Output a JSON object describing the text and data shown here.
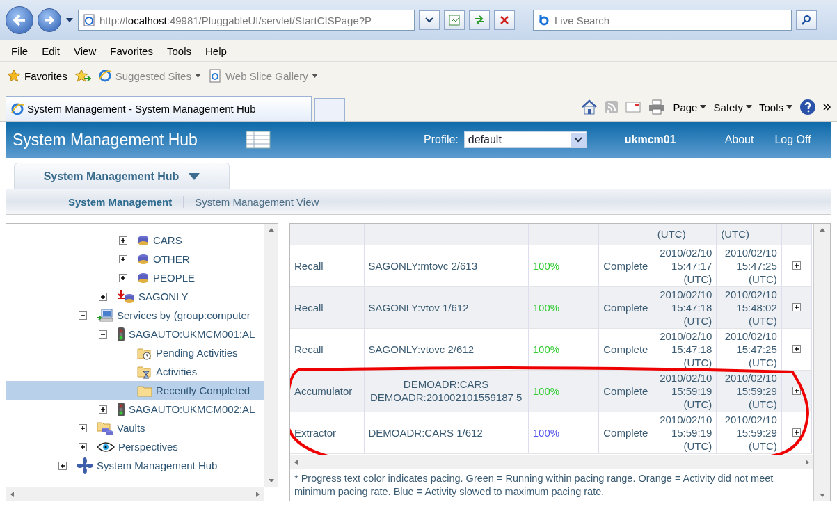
{
  "browser": {
    "address": "http://**localhost**:49981/PluggableUI/servlet/StartCISPage?P",
    "search": {
      "placeholder": "Live Search"
    },
    "menu": [
      "File",
      "Edit",
      "View",
      "Favorites",
      "Tools",
      "Help"
    ],
    "favorites": {
      "label": "Favorites",
      "links": [
        {
          "label": "Suggested Sites",
          "kind": "ie"
        },
        {
          "label": "Web Slice Gallery",
          "kind": "page"
        }
      ]
    },
    "tab": {
      "title": "System Management - System Management Hub"
    },
    "commands": [
      "Page",
      "Safety",
      "Tools"
    ]
  },
  "header": {
    "title": "System Management Hub",
    "profile_label": "Profile:",
    "profile": "default",
    "user": "ukmcm01",
    "links": [
      "About",
      "Log Off"
    ]
  },
  "hub_tab": {
    "label": "System Management Hub"
  },
  "subnav": [
    {
      "label": "System Management",
      "selected": true
    },
    {
      "label": "System Management View",
      "selected": false
    }
  ],
  "tree": [
    {
      "children": [
        {
          "children": [
            {
              "children": [
                {
                  "label": "CARS",
                  "kind": "database",
                  "expanded": false,
                  "selected": false
                },
                {
                  "label": "OTHER",
                  "kind": "database",
                  "expanded": false,
                  "selected": false
                },
                {
                  "label": "PEOPLE",
                  "kind": "database",
                  "expanded": false,
                  "selected": false
                }
              ]
            },
            {
              "label": "SAGONLY",
              "kind": "database-import",
              "expanded": false,
              "selected": false
            }
          ]
        },
        {
          "label": "Services by (group:computer",
          "kind": "computer",
          "expanded": true,
          "selected": false,
          "children": [
            {
              "label": "SAGAUTO:UKMCM001:AL",
              "kind": "traffic-light",
              "expanded": true,
              "selected": false,
              "children": [
                {
                  "label": "Pending Activities",
                  "kind": "folder-clock",
                  "selected": false
                },
                {
                  "label": "Activities",
                  "kind": "folder-hourglass",
                  "selected": false
                },
                {
                  "label": "Recently Completed",
                  "kind": "folder",
                  "selected": true
                }
              ]
            },
            {
              "label": "SAGAUTO:UKMCM002:AL",
              "kind": "traffic-light",
              "expanded": false,
              "selected": false
            }
          ]
        },
        {
          "label": "Vaults",
          "kind": "vaults",
          "expanded": false,
          "selected": false
        },
        {
          "label": "Perspectives",
          "kind": "eye",
          "expanded": false,
          "selected": false
        }
      ]
    },
    {
      "label": "System Management Hub",
      "kind": "hub",
      "expanded": false,
      "selected": false
    }
  ],
  "table": {
    "rows": [
      {
        "kind": "partial",
        "start": [
          "(UTC)"
        ],
        "end": [
          "(UTC)"
        ],
        "circled": false
      },
      {
        "kind": "full",
        "type": "Recall",
        "source": [
          "SAGONLY:mtovc 2/613"
        ],
        "progress": "100%",
        "color": "#33cc33",
        "status": "Complete",
        "start": [
          "2010/02/10",
          "15:47:17",
          "(UTC)"
        ],
        "end": [
          "2010/02/10",
          "15:47:25",
          "(UTC)"
        ],
        "circled": false
      },
      {
        "kind": "full",
        "type": "Recall",
        "source": [
          "SAGONLY:vtov 1/612"
        ],
        "progress": "100%",
        "color": "#33cc33",
        "status": "Complete",
        "start": [
          "2010/02/10",
          "15:47:18",
          "(UTC)"
        ],
        "end": [
          "2010/02/10",
          "15:48:02",
          "(UTC)"
        ],
        "circled": false
      },
      {
        "kind": "full",
        "type": "Recall",
        "source": [
          "SAGONLY:vtovc 2/612"
        ],
        "progress": "100%",
        "color": "#33cc33",
        "status": "Complete",
        "start": [
          "2010/02/10",
          "15:47:18",
          "(UTC)"
        ],
        "end": [
          "2010/02/10",
          "15:47:25",
          "(UTC)"
        ],
        "circled": false
      },
      {
        "kind": "full",
        "type": "Accumulator",
        "source": [
          "DEMOADR:CARS",
          "DEMOADR:201002101559187 5"
        ],
        "progress": "100%",
        "color": "#33cc33",
        "status": "Complete",
        "start": [
          "2010/02/10",
          "15:59:19",
          "(UTC)"
        ],
        "end": [
          "2010/02/10",
          "15:59:29",
          "(UTC)"
        ],
        "circled": true
      },
      {
        "kind": "full",
        "type": "Extractor",
        "source": [
          "DEMOADR:CARS 1/612"
        ],
        "progress": "100%",
        "color": "#5555ee",
        "status": "Complete",
        "start": [
          "2010/02/10",
          "15:59:19",
          "(UTC)"
        ],
        "end": [
          "2010/02/10",
          "15:59:29",
          "(UTC)"
        ],
        "circled": true
      }
    ]
  },
  "footnote": "* Progress text color indicates pacing. Green = Running within pacing range. Orange = Activity did not meet minimum pacing rate. Blue = Activity slowed to maximum pacing rate."
}
